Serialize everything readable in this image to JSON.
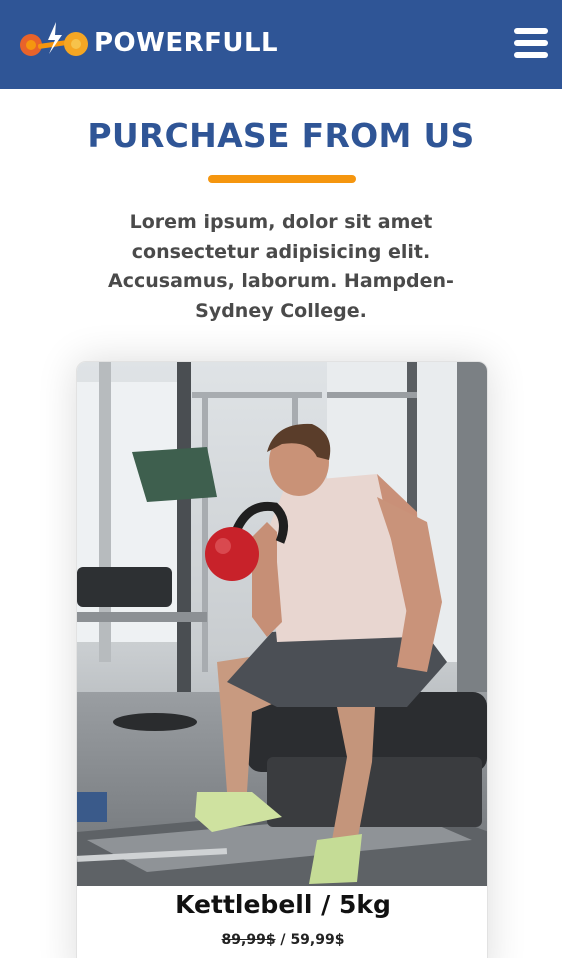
{
  "header": {
    "brand_name": "POWERFULL",
    "logo_icon": "dumbbell-lightning-icon",
    "menu_icon": "hamburger-menu-icon",
    "background_color": "#2f5596"
  },
  "section": {
    "title": "PURCHASE FROM US",
    "title_color": "#2f5596",
    "accent_color": "#f5960f",
    "intro": "Lorem ipsum, dolor sit amet consectetur adipisicing elit. Accusamus, laborum. Hampden-Sydney College."
  },
  "products": [
    {
      "image_icon": "man-lifting-kettlebell-photo",
      "name": "Kettlebell / 5kg",
      "old_price": "89,99$",
      "separator": " / ",
      "price": "59,99$"
    }
  ]
}
